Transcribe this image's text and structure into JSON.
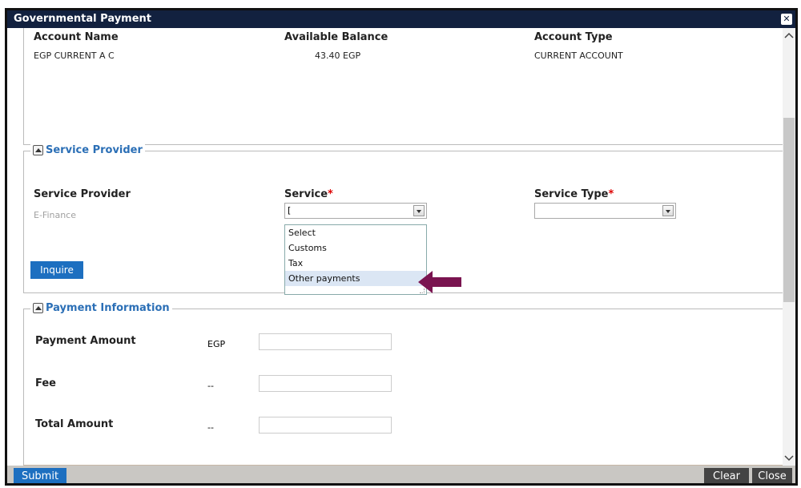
{
  "window": {
    "title": "Governmental Payment"
  },
  "account": {
    "headers": [
      "Account Name",
      "Available Balance",
      "Account Type"
    ],
    "values": [
      "EGP CURRENT A C",
      "43.40 EGP",
      "CURRENT ACCOUNT"
    ]
  },
  "service_provider_section": {
    "legend": "Service Provider",
    "provider_label": "Service Provider",
    "provider_value": "E-Finance",
    "service_label": "Service",
    "service_type_label": "Service Type",
    "required_mark": "*",
    "service_value": "[",
    "service_options": [
      "Select",
      "Customs",
      "Tax",
      "Other payments"
    ],
    "inquire_button": "Inquire"
  },
  "payment_section": {
    "legend": "Payment Information",
    "rows": [
      {
        "label": "Payment Amount",
        "currency": "EGP"
      },
      {
        "label": "Fee",
        "currency": "--"
      },
      {
        "label": "Total Amount",
        "currency": "--"
      }
    ]
  },
  "footer": {
    "submit": "Submit",
    "clear": "Clear",
    "close": "Close"
  },
  "colors": {
    "titlebar": "#12213f",
    "accent": "#2b6fb6",
    "button": "#1d6fc0",
    "pointer": "#7a1450",
    "required": "#dd0000"
  }
}
